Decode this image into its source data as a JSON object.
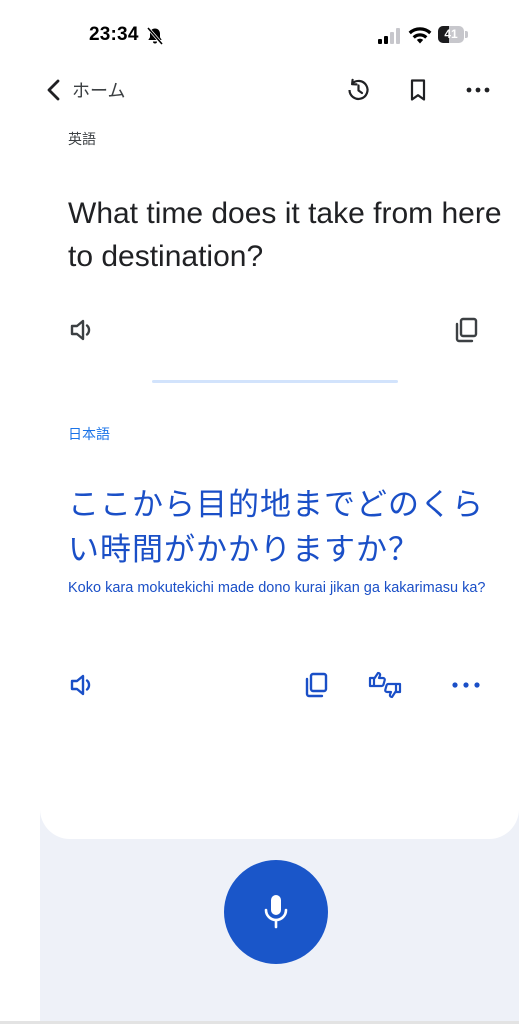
{
  "status_bar": {
    "time": "23:34",
    "battery_level": 41,
    "battery_text": "41"
  },
  "app_bar": {
    "back_label": "ホーム",
    "icons": [
      "chevron-left-icon",
      "history-icon",
      "bookmark-icon",
      "more-horizontal-icon"
    ]
  },
  "translation": {
    "source_language": "英語",
    "source_text": "What time does it take from here to destination?",
    "target_language": "日本語",
    "target_text": "ここから目的地までどのくらい時間がかかりますか？",
    "romanization": "Koko kara mokutekichi made dono kurai jikan ga kakarimasu ka?"
  },
  "source_actions": [
    "speaker-icon",
    "copy-icon"
  ],
  "target_actions": [
    "speaker-icon",
    "copy-icon",
    "feedback-thumbs-icon",
    "more-horizontal-icon"
  ],
  "input": {
    "mic_icon": "microphone-icon"
  },
  "colors": {
    "accent": "#1a73e8",
    "translated_text": "#1a4fc7",
    "mic_button": "#1a56c9",
    "bottom_panel": "#eef1f8",
    "divider": "#d2e3fc"
  }
}
